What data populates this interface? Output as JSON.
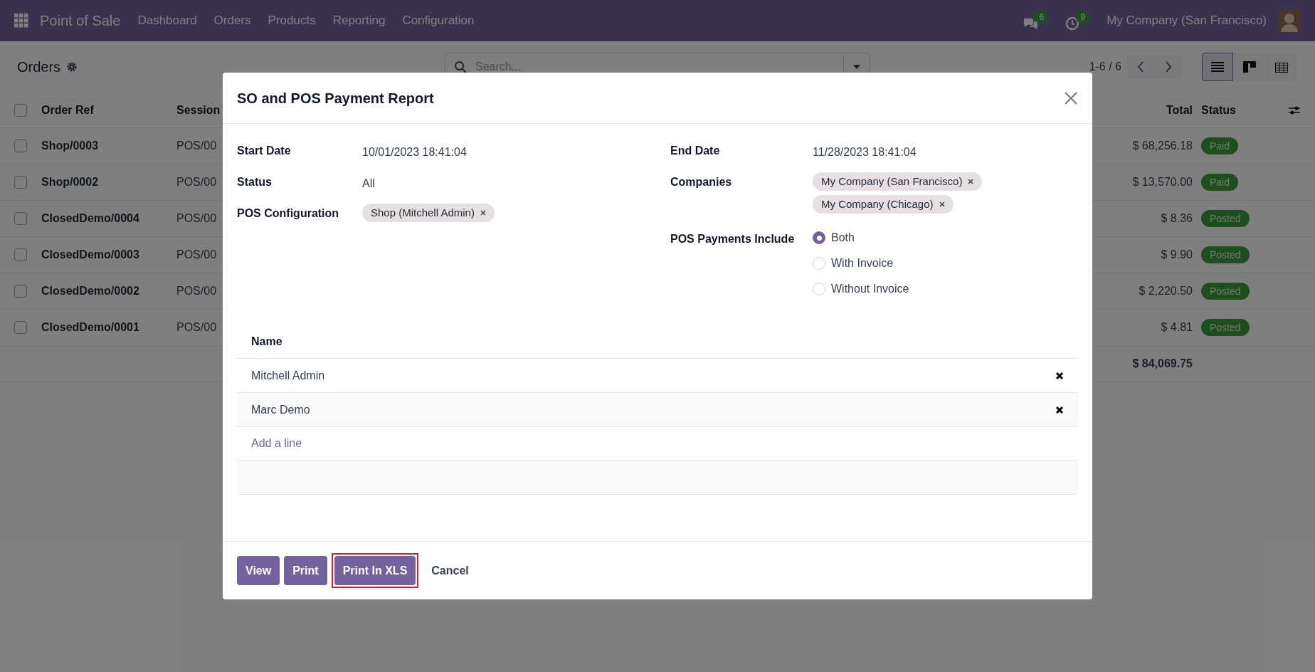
{
  "navbar": {
    "app_name": "Point of Sale",
    "menu": [
      "Dashboard",
      "Orders",
      "Products",
      "Reporting",
      "Configuration"
    ],
    "messages_badge": "6",
    "activities_badge": "9",
    "company": "My Company (San Francisco)"
  },
  "control_panel": {
    "title": "Orders",
    "search": {
      "placeholder": "Search..."
    },
    "pager": "1-6 / 6",
    "views": [
      {
        "kind": "list",
        "selected": true
      },
      {
        "kind": "kanban",
        "selected": false
      },
      {
        "kind": "pivot",
        "selected": false
      }
    ]
  },
  "table": {
    "columns": [
      "Order Ref",
      "Session",
      "Total",
      "Status"
    ],
    "header_checked": false,
    "rows": [
      {
        "order_ref": "Shop/0003",
        "session": "POS/00",
        "total": "$ 68,256.18",
        "status": "Paid",
        "checked": false
      },
      {
        "order_ref": "Shop/0002",
        "session": "POS/00",
        "total": "$ 13,570.00",
        "status": "Paid",
        "checked": false
      },
      {
        "order_ref": "ClosedDemo/0004",
        "session": "POS/00",
        "total": "$ 8.36",
        "status": "Posted",
        "checked": false
      },
      {
        "order_ref": "ClosedDemo/0003",
        "session": "POS/00",
        "total": "$ 9.90",
        "status": "Posted",
        "checked": false
      },
      {
        "order_ref": "ClosedDemo/0002",
        "session": "POS/00",
        "total": "$ 2,220.50",
        "status": "Posted",
        "checked": false
      },
      {
        "order_ref": "ClosedDemo/0001",
        "session": "POS/00",
        "total": "$ 4.81",
        "status": "Posted",
        "checked": false
      }
    ],
    "grand_total": "$ 84,069.75"
  },
  "dialog": {
    "title": "SO and POS Payment Report",
    "fields_left": [
      {
        "label": "Start Date",
        "kind": "text",
        "value": "10/01/2023 18:41:04"
      },
      {
        "label": "Status",
        "kind": "text",
        "value": "All"
      },
      {
        "label": "POS Configuration",
        "kind": "tags",
        "tags": [
          "Shop (Mitchell Admin)"
        ]
      }
    ],
    "fields_right": [
      {
        "label": "End Date",
        "kind": "text",
        "value": "11/28/2023 18:41:04"
      },
      {
        "label": "Companies",
        "kind": "tags",
        "tags": [
          "My Company (San Francisco)",
          "My Company (Chicago)"
        ]
      },
      {
        "label": "POS Payments Include",
        "kind": "radio",
        "options": [
          {
            "label": "Both",
            "selected": true
          },
          {
            "label": "With Invoice",
            "selected": false
          },
          {
            "label": "Without Invoice",
            "selected": false
          }
        ]
      }
    ],
    "lines": {
      "column": "Name",
      "rows": [
        "Mitchell Admin",
        "Marc Demo"
      ],
      "add_label": "Add a line"
    },
    "buttons": [
      {
        "label": "View",
        "kind": "primary",
        "highlighted": false
      },
      {
        "label": "Print",
        "kind": "primary",
        "highlighted": false
      },
      {
        "label": "Print In XLS",
        "kind": "primary",
        "highlighted": true
      },
      {
        "label": "Cancel",
        "kind": "link",
        "highlighted": false
      }
    ]
  }
}
